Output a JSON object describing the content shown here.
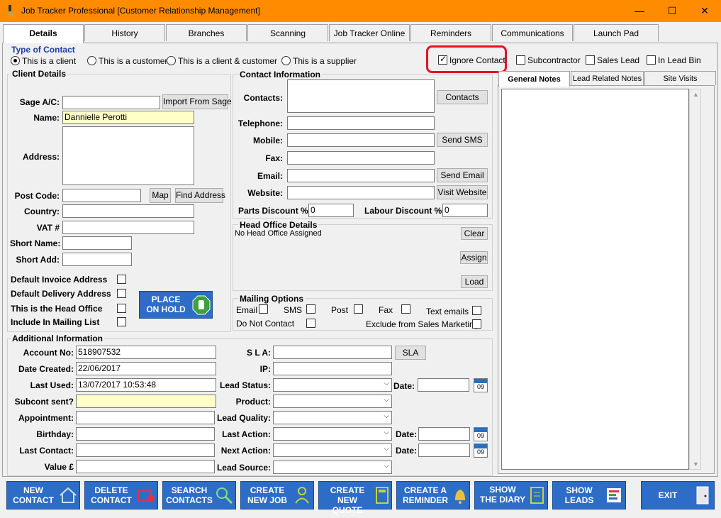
{
  "window": {
    "title": "Job Tracker Professional [Customer Relationship Management]",
    "min": "—",
    "max": "☐",
    "close": "✕"
  },
  "tabs": [
    "Details",
    "History",
    "Branches",
    "Scanning",
    "Job Tracker Online",
    "Reminders",
    "Communications",
    "Launch Pad"
  ],
  "type_of_contact": {
    "label": "Type of Contact",
    "options": [
      "This is a client",
      "This is a customer",
      "This is a client & customer",
      "This is a supplier"
    ],
    "selected": "This is a client"
  },
  "flags": {
    "ignore_contact": "Ignore Contact",
    "subcontractor": "Subcontractor",
    "sales_lead": "Sales Lead",
    "in_lead_bin": "In Lead Bin"
  },
  "client": {
    "label": "Client Details",
    "sage_label": "Sage A/C:",
    "import_btn": "Import From Sage",
    "name_label": "Name:",
    "name_value": "Dannielle Perotti",
    "address_label": "Address:",
    "postcode_label": "Post Code:",
    "map_btn": "Map",
    "find_btn": "Find Address",
    "country_label": "Country:",
    "vat_label": "VAT #",
    "short_name_label": "Short Name:",
    "short_add_label": "Short Add:",
    "default_invoice": "Default Invoice Address",
    "default_delivery": "Default Delivery Address",
    "head_office": "This is the Head Office",
    "mailing_list": "Include In Mailing List",
    "hold_btn_1": "PLACE",
    "hold_btn_2": "ON HOLD"
  },
  "contact": {
    "label": "Contact Information",
    "contacts_label": "Contacts:",
    "contacts_btn": "Contacts",
    "telephone_label": "Telephone:",
    "mobile_label": "Mobile:",
    "sms_btn": "Send SMS",
    "fax_label": "Fax:",
    "email_label": "Email:",
    "email_btn": "Send Email",
    "website_label": "Website:",
    "website_btn": "Visit Website",
    "parts_label": "Parts Discount %",
    "parts_value": "0",
    "labour_label": "Labour Discount %",
    "labour_value": "0"
  },
  "head_office": {
    "label": "Head Office Details",
    "value": "No Head Office Assigned",
    "clear": "Clear",
    "assign": "Assign",
    "load": "Load"
  },
  "mailing": {
    "label": "Mailing Options",
    "email": "Email",
    "sms": "SMS",
    "post": "Post",
    "fax": "Fax",
    "text_emails": "Text emails",
    "do_not_contact": "Do Not Contact",
    "exclude": "Exclude from Sales Marketing"
  },
  "notes_tabs": [
    "General Notes",
    "Lead Related Notes",
    "Site Visits"
  ],
  "additional": {
    "label": "Additional Information",
    "account_label": "Account No:",
    "account_value": "518907532",
    "created_label": "Date Created:",
    "created_value": "22/06/2017",
    "last_used_label": "Last Used:",
    "last_used_value": "13/07/2017 10:53:48",
    "subcont_label": "Subcont sent?",
    "appointment_label": "Appointment:",
    "birthday_label": "Birthday:",
    "last_contact_label": "Last Contact:",
    "value_label": "Value £",
    "sla_label": "S L A:",
    "sla_btn": "SLA",
    "ip_label": "IP:",
    "lead_status_label": "Lead Status:",
    "product_label": "Product:",
    "lead_quality_label": "Lead Quality:",
    "last_action_label": "Last Action:",
    "next_action_label": "Next Action:",
    "lead_source_label": "Lead Source:",
    "date_label": "Date:",
    "cal_text": "09"
  },
  "bottom_buttons": [
    {
      "l1": "NEW",
      "l2": "CONTACT"
    },
    {
      "l1": "DELETE",
      "l2": "CONTACT"
    },
    {
      "l1": "SEARCH",
      "l2": "CONTACTS"
    },
    {
      "l1": "CREATE",
      "l2": "NEW JOB"
    },
    {
      "l1": "CREATE",
      "l2": "NEW QUOTE"
    },
    {
      "l1": "CREATE A",
      "l2": "REMINDER"
    },
    {
      "l1": "SHOW",
      "l2": "THE DIARY"
    },
    {
      "l1": "SHOW",
      "l2": "LEADS"
    },
    {
      "l1": "EXIT",
      "l2": ""
    }
  ],
  "colors": {
    "titlebar": "#ff8c00",
    "button_blue": "#2d6dc7",
    "highlight": "#e81123"
  }
}
